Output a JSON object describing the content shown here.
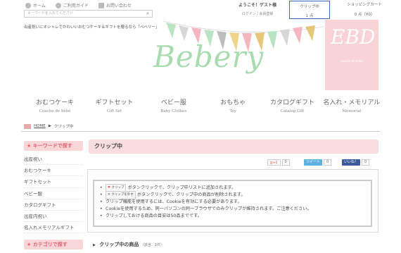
{
  "header": {
    "nav_links": [
      {
        "label": "ホーム",
        "icon": "house-icon"
      },
      {
        "label": "ご利用ガイド",
        "icon": "question-icon"
      },
      {
        "label": "お問い合わせ",
        "icon": "mail-icon"
      }
    ],
    "search_placeholder": "キーワードを入れてください",
    "welcome_text": "ようこそ！ゲスト様",
    "login_text": "ログイン / 会員登録",
    "clip_label": "クリップ中",
    "clip_count": "1 点",
    "cart_label": "ショッピングカート",
    "cart_summary": "0 点（¥0）",
    "tagline": "出産祝いにオシャレでかわいいおむつケーキ＆ギフトを贈るなら「ベベリー」",
    "logo_text": "Bebery",
    "ebd_monogram": "EBD",
    "ebd_sub": "couche de bebe"
  },
  "menu": [
    {
      "jp": "おむつケーキ",
      "en": "Couche de bébé"
    },
    {
      "jp": "ギフトセット",
      "en": "Gift Set"
    },
    {
      "jp": "ベビー服",
      "en": "Baby Clothes"
    },
    {
      "jp": "おもちゃ",
      "en": "Toy"
    },
    {
      "jp": "カタログギフト",
      "en": "Catalog Gift"
    },
    {
      "jp": "名入れ・メモリアル",
      "en": "Memorial"
    }
  ],
  "breadcrumb": {
    "home": "HOME",
    "sep": "▶",
    "current": "クリップ中"
  },
  "sidebar": {
    "keyword_title": "キーワードで探す",
    "keywords": [
      "出産祝い",
      "おむつケーキ",
      "ギフトセット",
      "ベビー服",
      "カタログギフト",
      "出産内祝い",
      "名入れメモリアルギフト"
    ],
    "category_title": "カテゴリで探す"
  },
  "main": {
    "title": "クリップ中",
    "social": {
      "gplus": "g+1",
      "gplus_count": "0",
      "tweet": "ツイート",
      "tweet_count": "0",
      "fb_like": "いいね！",
      "fb_count": "0"
    },
    "clip_button_label": "クリップ",
    "clip_remove_label": "クリップを外す",
    "notes": [
      "ボタンクリックで、クリップ中リストに追加されます。",
      "ボタンクリックで、クリップ中の商品が削除されます。",
      "クリップ機能を使用するには、Cookieを有効にする必要があります。",
      "Cookieを使用するため、同一パソコンの同一ブラウザでのみクリップが維持されます。ご注意ください。",
      "クリップしておける商品の目安は50品までです。"
    ],
    "section_title": "クリップ中の商品",
    "section_count": "（該当：1件）"
  },
  "colors": {
    "accent_pink": "#f9d7d9",
    "pink_text": "#e26273",
    "logo_green": "#a9dbb0",
    "clip_border": "#3b66b6",
    "twitter": "#5fb1e0",
    "facebook": "#3b5998",
    "gplus": "#dd4b39"
  }
}
